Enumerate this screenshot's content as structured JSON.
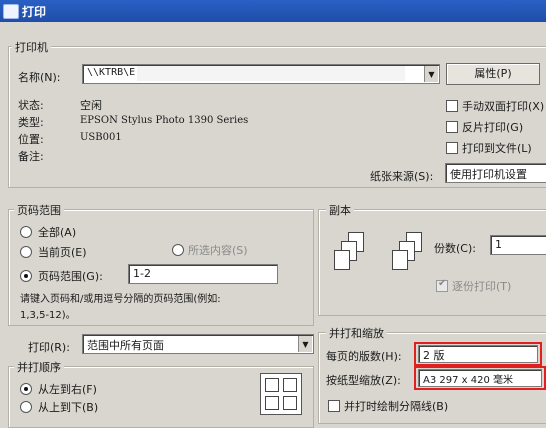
{
  "window": {
    "title": "打印"
  },
  "printer_group": {
    "legend": "打印机",
    "name_label": "名称(N):",
    "name_value": "\\\\KTRB\\E",
    "properties_button": "属性(P)",
    "status_label": "状态:",
    "status_value": "空闲",
    "type_label": "类型:",
    "type_value": "EPSON Stylus Photo 1390 Series",
    "where_label": "位置:",
    "where_value": "USB001",
    "comment_label": "备注:",
    "manual_duplex": "手动双面打印(X)",
    "reverse_print": "反片打印(G)",
    "print_to_file": "打印到文件(L)",
    "paper_source_label": "纸张来源(S):",
    "paper_source_value": "使用打印机设置"
  },
  "page_range": {
    "legend": "页码范围",
    "all": "全部(A)",
    "current": "当前页(E)",
    "selection": "所选内容(S)",
    "pages": "页码范围(G):",
    "pages_value": "1-2",
    "hint": "请键入页码和/或用逗号分隔的页码范围(例如:",
    "hint2": "1,3,5-12)。"
  },
  "print_what": {
    "label": "打印(R):",
    "value": "范围中所有页面"
  },
  "print_order": {
    "legend": "并打顺序",
    "left_to_right": "从左到右(F)",
    "top_to_bottom": "从上到下(B)"
  },
  "copies": {
    "legend": "副本",
    "count_label": "份数(C):",
    "count_value": "1",
    "collate": "逐份打印(T)"
  },
  "zoom": {
    "legend": "并打和缩放",
    "pages_per_sheet_label": "每页的版数(H):",
    "pages_per_sheet_value": "2 版",
    "scale_label": "按纸型缩放(Z):",
    "scale_value": "A3 297 x 420 毫米",
    "print_borders": "并打时绘制分隔线(B)"
  }
}
